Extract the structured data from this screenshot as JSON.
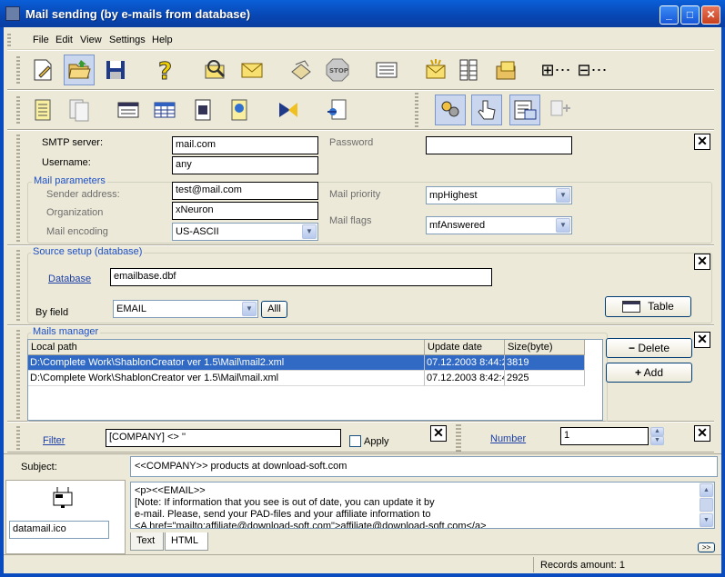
{
  "window": {
    "title": "Mail sending (by e-mails from database)"
  },
  "menu": [
    "File",
    "Edit",
    "View",
    "Settings",
    "Help"
  ],
  "toolbar1_icons": [
    "new-document-icon",
    "open-folder-icon",
    "save-disk-icon",
    "help-question-icon",
    "edit-mail-icon",
    "envelope-icon",
    "send-mail-icon",
    "stop-icon",
    "form-icon",
    "new-mail-icon",
    "table-list-icon",
    "mail-folder-icon",
    "expand-icon",
    "collapse-icon"
  ],
  "toolbar2_icons": [
    "page-icon",
    "pages-icon",
    "window-icon",
    "grid-icon",
    "pda-icon",
    "web-page-icon",
    "merge-icon",
    "attach-icon",
    "users-icon",
    "hand-pointer-icon",
    "form-fill-icon",
    "link-icon"
  ],
  "smtp": {
    "server_label": "SMTP server:",
    "server_value": "mail.com",
    "username_label": "Username:",
    "username_value": "any",
    "password_label": "Password",
    "password_value": ""
  },
  "mail_params": {
    "title": "Mail parameters",
    "sender_label": "Sender address:",
    "sender_value": "test@mail.com",
    "org_label": "Organization",
    "org_value": "xNeuron",
    "encoding_label": "Mail encoding",
    "encoding_value": "US-ASCII",
    "priority_label": "Mail priority",
    "priority_value": "mpHighest",
    "flags_label": "Mail flags",
    "flags_value": "mfAnswered"
  },
  "source": {
    "title": "Source setup (database)",
    "database_link": "Database",
    "database_value": "emailbase.dbf",
    "byfield_label": "By field",
    "byfield_value": "EMAIL",
    "all_button": "Alll",
    "table_button": "Table"
  },
  "mails": {
    "title": "Mails manager",
    "columns": [
      "Local path",
      "Update date",
      "Size(byte)"
    ],
    "rows": [
      [
        "D:\\Complete Work\\ShablonCreator ver 1.5\\Mail\\mail2.xml",
        "07.12.2003 8:44:2",
        "3819"
      ],
      [
        "D:\\Complete Work\\ShablonCreator ver 1.5\\Mail\\mail.xml",
        "07.12.2003 8:42:4",
        "2925"
      ]
    ],
    "delete_button": "Delete",
    "add_button": "Add"
  },
  "filter": {
    "link": "Filter",
    "value": "[COMPANY] <> ''",
    "apply_label": "Apply",
    "apply_checked": false
  },
  "number": {
    "link": "Number",
    "value": "1"
  },
  "subject": {
    "label": "Subject:",
    "value": "<<COMPANY>> products at download-soft.com"
  },
  "body": {
    "lines": [
      "<p><<EMAIL>>",
      "[Note: If information that you see is out of date, you can update it by",
      "e-mail. Please, send your PAD-files and your affiliate information to",
      "<A href=\"mailto:affiliate@download-soft.com\">affiliate@download-soft.com</a>"
    ],
    "icon_file": "datamail.ico",
    "tabs": [
      "Text",
      "HTML"
    ],
    "active_tab": "HTML",
    "more_button": ">>"
  },
  "status": {
    "records": "Records amount: 1"
  }
}
